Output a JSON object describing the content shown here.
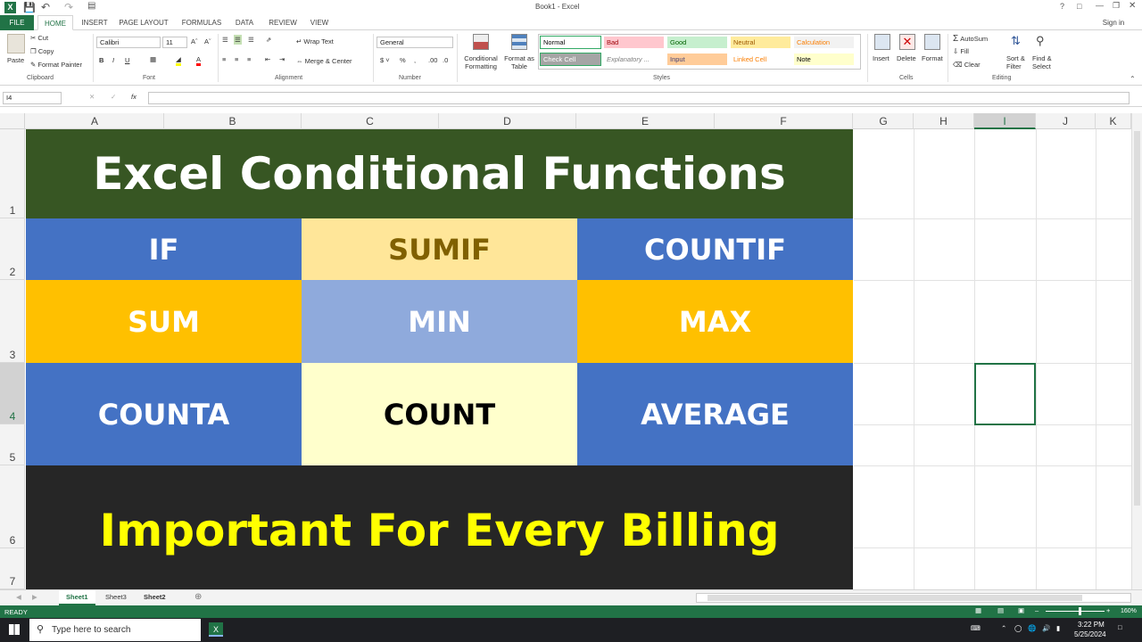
{
  "window": {
    "title": "Book1 - Excel",
    "signin": "Sign in"
  },
  "tabs": [
    "FILE",
    "HOME",
    "INSERT",
    "PAGE LAYOUT",
    "FORMULAS",
    "DATA",
    "REVIEW",
    "VIEW"
  ],
  "ribbon": {
    "clipboard": {
      "paste": "Paste",
      "cut": "Cut",
      "copy": "Copy",
      "format_painter": "Format Painter",
      "label": "Clipboard"
    },
    "font": {
      "name": "Calibri",
      "size": "11",
      "label": "Font"
    },
    "alignment": {
      "wrap": "Wrap Text",
      "merge": "Merge & Center",
      "label": "Alignment"
    },
    "number": {
      "format": "General",
      "label": "Number"
    },
    "styles": {
      "conditional": "Conditional\nFormatting",
      "format_table": "Format as\nTable",
      "label": "Styles",
      "cells": [
        {
          "text": "Normal",
          "bg": "#ffffff",
          "fg": "#000000"
        },
        {
          "text": "Bad",
          "bg": "#ffc7ce",
          "fg": "#9c0006"
        },
        {
          "text": "Good",
          "bg": "#c6efce",
          "fg": "#006100"
        },
        {
          "text": "Neutral",
          "bg": "#ffeb9c",
          "fg": "#9c5700"
        },
        {
          "text": "Calculation",
          "bg": "#f2f2f2",
          "fg": "#fa7d00"
        },
        {
          "text": "Check Cell",
          "bg": "#a5a5a5",
          "fg": "#ffffff"
        },
        {
          "text": "Explanatory ...",
          "bg": "#ffffff",
          "fg": "#7f7f7f"
        },
        {
          "text": "Input",
          "bg": "#ffcc99",
          "fg": "#3f3f76"
        },
        {
          "text": "Linked Cell",
          "bg": "#ffffff",
          "fg": "#fa7d00"
        },
        {
          "text": "Note",
          "bg": "#ffffcc",
          "fg": "#000000"
        }
      ]
    },
    "cells": {
      "insert": "Insert",
      "delete": "Delete",
      "format": "Format",
      "label": "Cells"
    },
    "editing": {
      "autosum": "AutoSum",
      "fill": "Fill",
      "clear": "Clear",
      "sort": "Sort &\nFilter",
      "find": "Find &\nSelect",
      "label": "Editing"
    }
  },
  "formula_bar": {
    "name_box": "I4",
    "formula": ""
  },
  "columns": [
    "A",
    "B",
    "C",
    "D",
    "E",
    "F",
    "G",
    "H",
    "I",
    "J",
    "K"
  ],
  "rows": [
    "1",
    "2",
    "3",
    "4",
    "5",
    "6",
    "7"
  ],
  "sheet": {
    "title": "Excel Conditional Functions",
    "grid": [
      [
        {
          "text": "IF",
          "bg": "#4472c4",
          "fg": "#ffffff"
        },
        {
          "text": "SUMIF",
          "bg": "#ffe699",
          "fg": "#806000"
        },
        {
          "text": "COUNTIF",
          "bg": "#4472c4",
          "fg": "#ffffff"
        }
      ],
      [
        {
          "text": "SUM",
          "bg": "#ffc000",
          "fg": "#ffffff"
        },
        {
          "text": "MIN",
          "bg": "#8faadc",
          "fg": "#ffffff"
        },
        {
          "text": "MAX",
          "bg": "#ffc000",
          "fg": "#ffffff"
        }
      ],
      [
        {
          "text": "COUNTA",
          "bg": "#4472c4",
          "fg": "#ffffff"
        },
        {
          "text": "COUNT",
          "bg": "#ffffcc",
          "fg": "#000000"
        },
        {
          "text": "AVERAGE",
          "bg": "#4472c4",
          "fg": "#ffffff"
        }
      ]
    ],
    "footer": "Important For Every Billing",
    "title_bg": "#375623",
    "footer_bg": "#262626",
    "footer_fg": "#ffff00"
  },
  "sheet_tabs": [
    "Sheet1",
    "Sheet3",
    "Sheet2"
  ],
  "status": {
    "text": "READY",
    "zoom": "160%"
  },
  "taskbar": {
    "search": "Type here to search",
    "time": "3:22 PM",
    "date": "5/25/2024"
  }
}
